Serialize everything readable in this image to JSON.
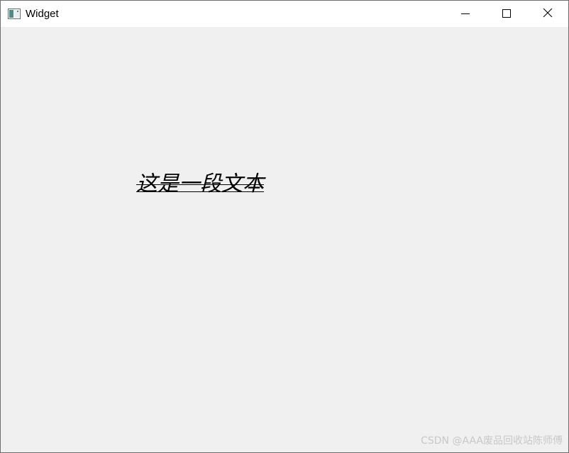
{
  "window": {
    "title": "Widget",
    "icon": "qt-window-icon",
    "controls": {
      "minimize_icon": "minimize-icon",
      "maximize_icon": "maximize-icon",
      "close_icon": "close-icon"
    }
  },
  "content": {
    "text": "这是一段文本",
    "text_color": "#000000",
    "background_color": "#f0f0f0"
  },
  "watermark": {
    "text": "CSDN @AAA废品回收站陈师傅"
  }
}
